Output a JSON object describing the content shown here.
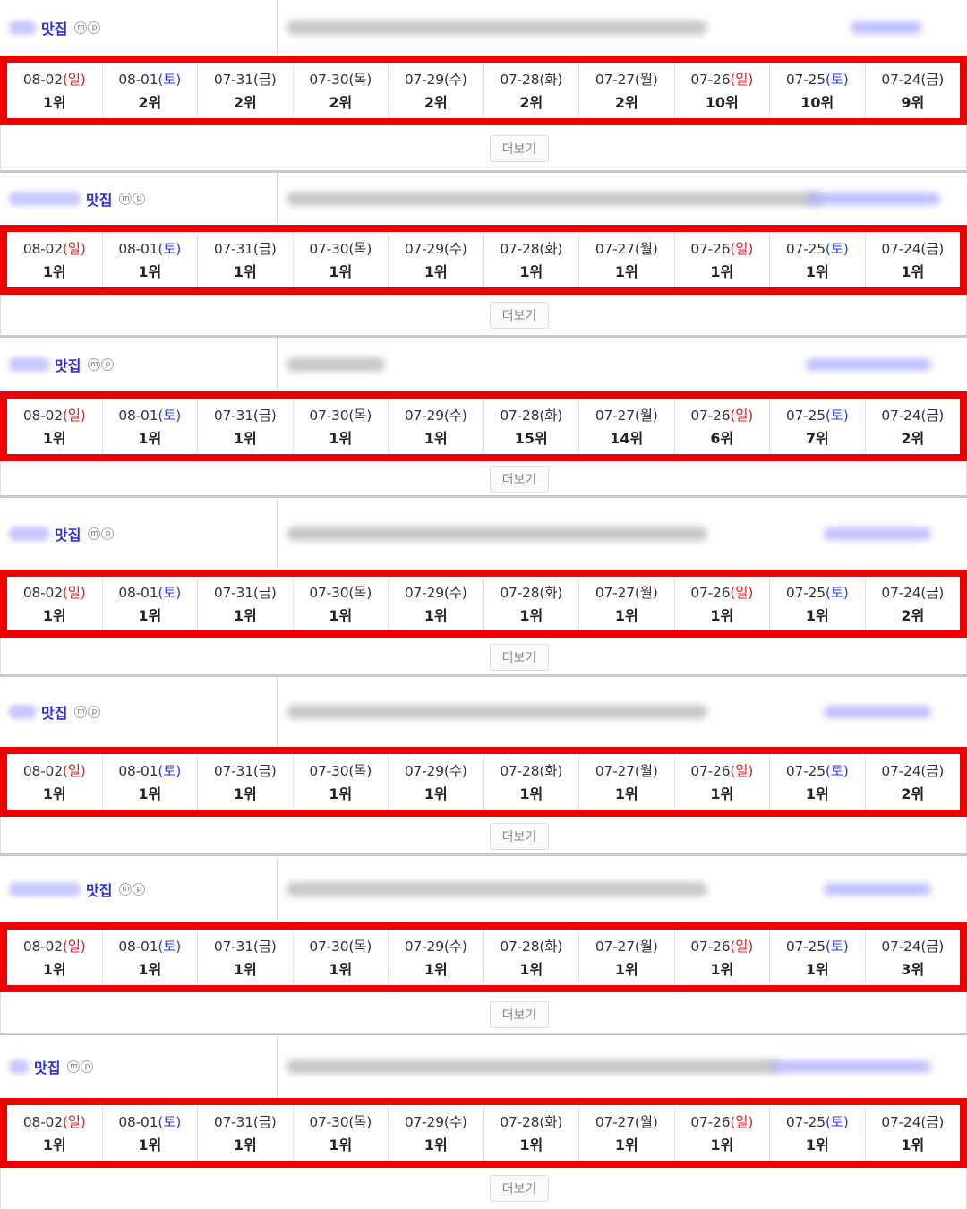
{
  "more_label": "더보기",
  "keyword_suffix": "맛집",
  "mp_icons": [
    "m",
    "p"
  ],
  "rows": [
    {
      "dates": [
        {
          "date": "08-02",
          "dow": "(일)",
          "kind": "sun",
          "rank": "1위"
        },
        {
          "date": "08-01",
          "dow": "(토)",
          "kind": "sat",
          "rank": "2위"
        },
        {
          "date": "07-31",
          "dow": "(금)",
          "kind": "wk",
          "rank": "2위"
        },
        {
          "date": "07-30",
          "dow": "(목)",
          "kind": "wk",
          "rank": "2위"
        },
        {
          "date": "07-29",
          "dow": "(수)",
          "kind": "wk",
          "rank": "2위"
        },
        {
          "date": "07-28",
          "dow": "(화)",
          "kind": "wk",
          "rank": "2위"
        },
        {
          "date": "07-27",
          "dow": "(월)",
          "kind": "wk",
          "rank": "2위"
        },
        {
          "date": "07-26",
          "dow": "(일)",
          "kind": "sun",
          "rank": "10위"
        },
        {
          "date": "07-25",
          "dow": "(토)",
          "kind": "sat",
          "rank": "10위"
        },
        {
          "date": "07-24",
          "dow": "(금)",
          "kind": "wk",
          "rank": "9위"
        }
      ]
    },
    {
      "dates": [
        {
          "date": "08-02",
          "dow": "(일)",
          "kind": "sun",
          "rank": "1위"
        },
        {
          "date": "08-01",
          "dow": "(토)",
          "kind": "sat",
          "rank": "1위"
        },
        {
          "date": "07-31",
          "dow": "(금)",
          "kind": "wk",
          "rank": "1위"
        },
        {
          "date": "07-30",
          "dow": "(목)",
          "kind": "wk",
          "rank": "1위"
        },
        {
          "date": "07-29",
          "dow": "(수)",
          "kind": "wk",
          "rank": "1위"
        },
        {
          "date": "07-28",
          "dow": "(화)",
          "kind": "wk",
          "rank": "1위"
        },
        {
          "date": "07-27",
          "dow": "(월)",
          "kind": "wk",
          "rank": "1위"
        },
        {
          "date": "07-26",
          "dow": "(일)",
          "kind": "sun",
          "rank": "1위"
        },
        {
          "date": "07-25",
          "dow": "(토)",
          "kind": "sat",
          "rank": "1위"
        },
        {
          "date": "07-24",
          "dow": "(금)",
          "kind": "wk",
          "rank": "1위"
        }
      ]
    },
    {
      "dates": [
        {
          "date": "08-02",
          "dow": "(일)",
          "kind": "sun",
          "rank": "1위"
        },
        {
          "date": "08-01",
          "dow": "(토)",
          "kind": "sat",
          "rank": "1위"
        },
        {
          "date": "07-31",
          "dow": "(금)",
          "kind": "wk",
          "rank": "1위"
        },
        {
          "date": "07-30",
          "dow": "(목)",
          "kind": "wk",
          "rank": "1위"
        },
        {
          "date": "07-29",
          "dow": "(수)",
          "kind": "wk",
          "rank": "1위"
        },
        {
          "date": "07-28",
          "dow": "(화)",
          "kind": "wk",
          "rank": "15위"
        },
        {
          "date": "07-27",
          "dow": "(월)",
          "kind": "wk",
          "rank": "14위"
        },
        {
          "date": "07-26",
          "dow": "(일)",
          "kind": "sun",
          "rank": "6위"
        },
        {
          "date": "07-25",
          "dow": "(토)",
          "kind": "sat",
          "rank": "7위"
        },
        {
          "date": "07-24",
          "dow": "(금)",
          "kind": "wk",
          "rank": "2위"
        }
      ]
    },
    {
      "dates": [
        {
          "date": "08-02",
          "dow": "(일)",
          "kind": "sun",
          "rank": "1위"
        },
        {
          "date": "08-01",
          "dow": "(토)",
          "kind": "sat",
          "rank": "1위"
        },
        {
          "date": "07-31",
          "dow": "(금)",
          "kind": "wk",
          "rank": "1위"
        },
        {
          "date": "07-30",
          "dow": "(목)",
          "kind": "wk",
          "rank": "1위"
        },
        {
          "date": "07-29",
          "dow": "(수)",
          "kind": "wk",
          "rank": "1위"
        },
        {
          "date": "07-28",
          "dow": "(화)",
          "kind": "wk",
          "rank": "1위"
        },
        {
          "date": "07-27",
          "dow": "(월)",
          "kind": "wk",
          "rank": "1위"
        },
        {
          "date": "07-26",
          "dow": "(일)",
          "kind": "sun",
          "rank": "1위"
        },
        {
          "date": "07-25",
          "dow": "(토)",
          "kind": "sat",
          "rank": "1위"
        },
        {
          "date": "07-24",
          "dow": "(금)",
          "kind": "wk",
          "rank": "2위"
        }
      ]
    },
    {
      "dates": [
        {
          "date": "08-02",
          "dow": "(일)",
          "kind": "sun",
          "rank": "1위"
        },
        {
          "date": "08-01",
          "dow": "(토)",
          "kind": "sat",
          "rank": "1위"
        },
        {
          "date": "07-31",
          "dow": "(금)",
          "kind": "wk",
          "rank": "1위"
        },
        {
          "date": "07-30",
          "dow": "(목)",
          "kind": "wk",
          "rank": "1위"
        },
        {
          "date": "07-29",
          "dow": "(수)",
          "kind": "wk",
          "rank": "1위"
        },
        {
          "date": "07-28",
          "dow": "(화)",
          "kind": "wk",
          "rank": "1위"
        },
        {
          "date": "07-27",
          "dow": "(월)",
          "kind": "wk",
          "rank": "1위"
        },
        {
          "date": "07-26",
          "dow": "(일)",
          "kind": "sun",
          "rank": "1위"
        },
        {
          "date": "07-25",
          "dow": "(토)",
          "kind": "sat",
          "rank": "1위"
        },
        {
          "date": "07-24",
          "dow": "(금)",
          "kind": "wk",
          "rank": "2위"
        }
      ]
    },
    {
      "dates": [
        {
          "date": "08-02",
          "dow": "(일)",
          "kind": "sun",
          "rank": "1위"
        },
        {
          "date": "08-01",
          "dow": "(토)",
          "kind": "sat",
          "rank": "1위"
        },
        {
          "date": "07-31",
          "dow": "(금)",
          "kind": "wk",
          "rank": "1위"
        },
        {
          "date": "07-30",
          "dow": "(목)",
          "kind": "wk",
          "rank": "1위"
        },
        {
          "date": "07-29",
          "dow": "(수)",
          "kind": "wk",
          "rank": "1위"
        },
        {
          "date": "07-28",
          "dow": "(화)",
          "kind": "wk",
          "rank": "1위"
        },
        {
          "date": "07-27",
          "dow": "(월)",
          "kind": "wk",
          "rank": "1위"
        },
        {
          "date": "07-26",
          "dow": "(일)",
          "kind": "sun",
          "rank": "1위"
        },
        {
          "date": "07-25",
          "dow": "(토)",
          "kind": "sat",
          "rank": "1위"
        },
        {
          "date": "07-24",
          "dow": "(금)",
          "kind": "wk",
          "rank": "3위"
        }
      ]
    },
    {
      "dates": [
        {
          "date": "08-02",
          "dow": "(일)",
          "kind": "sun",
          "rank": "1위"
        },
        {
          "date": "08-01",
          "dow": "(토)",
          "kind": "sat",
          "rank": "1위"
        },
        {
          "date": "07-31",
          "dow": "(금)",
          "kind": "wk",
          "rank": "1위"
        },
        {
          "date": "07-30",
          "dow": "(목)",
          "kind": "wk",
          "rank": "1위"
        },
        {
          "date": "07-29",
          "dow": "(수)",
          "kind": "wk",
          "rank": "1위"
        },
        {
          "date": "07-28",
          "dow": "(화)",
          "kind": "wk",
          "rank": "1위"
        },
        {
          "date": "07-27",
          "dow": "(월)",
          "kind": "wk",
          "rank": "1위"
        },
        {
          "date": "07-26",
          "dow": "(일)",
          "kind": "sun",
          "rank": "1위"
        },
        {
          "date": "07-25",
          "dow": "(토)",
          "kind": "sat",
          "rank": "1위"
        },
        {
          "date": "07-24",
          "dow": "(금)",
          "kind": "wk",
          "rank": "1위"
        }
      ]
    }
  ]
}
